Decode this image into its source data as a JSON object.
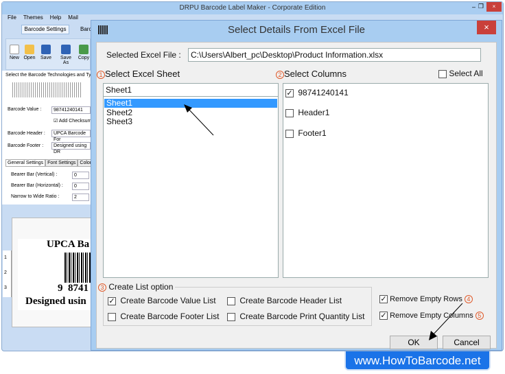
{
  "app": {
    "title": "DRPU Barcode Label Maker - Corporate Edition",
    "menu": [
      "File",
      "Themes",
      "Help",
      "Mail"
    ],
    "tabs": [
      "Barcode Settings",
      "Barc"
    ],
    "toolbar": [
      "New",
      "Open",
      "Save",
      "Save As",
      "Copy"
    ],
    "tech_label": "Select the Barcode Technologies and Type",
    "barcode_value_label": "Barcode Value :",
    "barcode_value": "98741240141",
    "add_checksum": "Add Checksum",
    "header_label": "Barcode Header :",
    "header_value": "UPCA Barcode For",
    "footer_label": "Barcode Footer :",
    "footer_value": "Designed using DR",
    "settings_tabs": [
      "General Settings",
      "Font Settings",
      "Color S"
    ],
    "bearer_v_label": "Bearer Bar (Vertical) :",
    "bearer_v": "0",
    "bearer_h_label": "Bearer Bar (Horizontal) :",
    "bearer_h": "0",
    "ratio_label": "Narrow to Wide Ratio :",
    "ratio": "2",
    "preview": {
      "header": "UPCA Ba",
      "digits": "9  8741",
      "footer": "Designed usin",
      "ruler": [
        "1",
        "2",
        "3"
      ]
    }
  },
  "dialog": {
    "title": "Select Details From Excel File",
    "close": "×",
    "file_label": "Selected Excel File :",
    "file_path": "C:\\Users\\Albert_pc\\Desktop\\Product Information.xlsx",
    "sheet_heading": "Select Excel Sheet",
    "sheet_step": "1",
    "sheet_current": "Sheet1",
    "sheets": [
      "Sheet1",
      "Sheet2",
      "Sheet3"
    ],
    "columns_heading": "Select  Columns",
    "columns_step": "2",
    "select_all": "Select All",
    "columns": [
      {
        "label": "98741240141",
        "checked": true
      },
      {
        "label": "Header1",
        "checked": false
      },
      {
        "label": "Footer1",
        "checked": false
      }
    ],
    "list_heading": "Create List option",
    "list_step": "3",
    "list_options": [
      {
        "label": "Create Barcode Value List",
        "checked": true
      },
      {
        "label": "Create Barcode Header List",
        "checked": false
      },
      {
        "label": "Create Barcode Footer List",
        "checked": false
      },
      {
        "label": "Create Barcode Print Quantity List",
        "checked": false
      }
    ],
    "remove_rows": "Remove Empty Rows",
    "rows_step": "4",
    "remove_cols": "Remove Empty Columns",
    "cols_step": "5",
    "ok": "OK",
    "cancel": "Cancel"
  },
  "watermark": "www.HowToBarcode.net",
  "colors": {
    "selection": "#3399ff",
    "step": "#e05a2a",
    "close": "#c9403b",
    "watermark": "#1a73e8"
  }
}
